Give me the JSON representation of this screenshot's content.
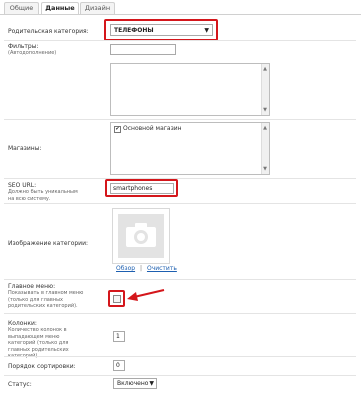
{
  "tabs": [
    {
      "label": "Общие",
      "active": false
    },
    {
      "label": "Данные",
      "active": true
    },
    {
      "label": "Дизайн",
      "active": false
    }
  ],
  "form": {
    "parent_category": {
      "label": "Родительская категория:",
      "value": "ТЕЛЕФОНЫ"
    },
    "filters": {
      "label": "Фильтры:",
      "help": "(Автодополнение)",
      "value": ""
    },
    "stores": {
      "label": "Магазины:",
      "items": [
        {
          "label": "Основной магазин",
          "checked": true
        }
      ]
    },
    "seo_url": {
      "label": "SEO URL:",
      "help": "Должно быть уникальным на всю систему.",
      "value": "smartphones"
    },
    "image": {
      "label": "Изображение категории:",
      "browse": "Обзор",
      "separator": "|",
      "clear": "Очистить"
    },
    "top_menu": {
      "label": "Главное меню:",
      "help": "Показывать в главном меню (только для главных родительских категорий).",
      "checked": false
    },
    "columns": {
      "label": "Колонки:",
      "help": "Количество колонок в выпадающем меню категорий (только для главных родительских категорий)",
      "value": "1"
    },
    "sort_order": {
      "label": "Порядок сортировки:",
      "value": "0"
    },
    "status": {
      "label": "Статус:",
      "value": "Включено"
    }
  },
  "colors": {
    "highlight": "#d4161b",
    "link": "#1d5fb0"
  }
}
